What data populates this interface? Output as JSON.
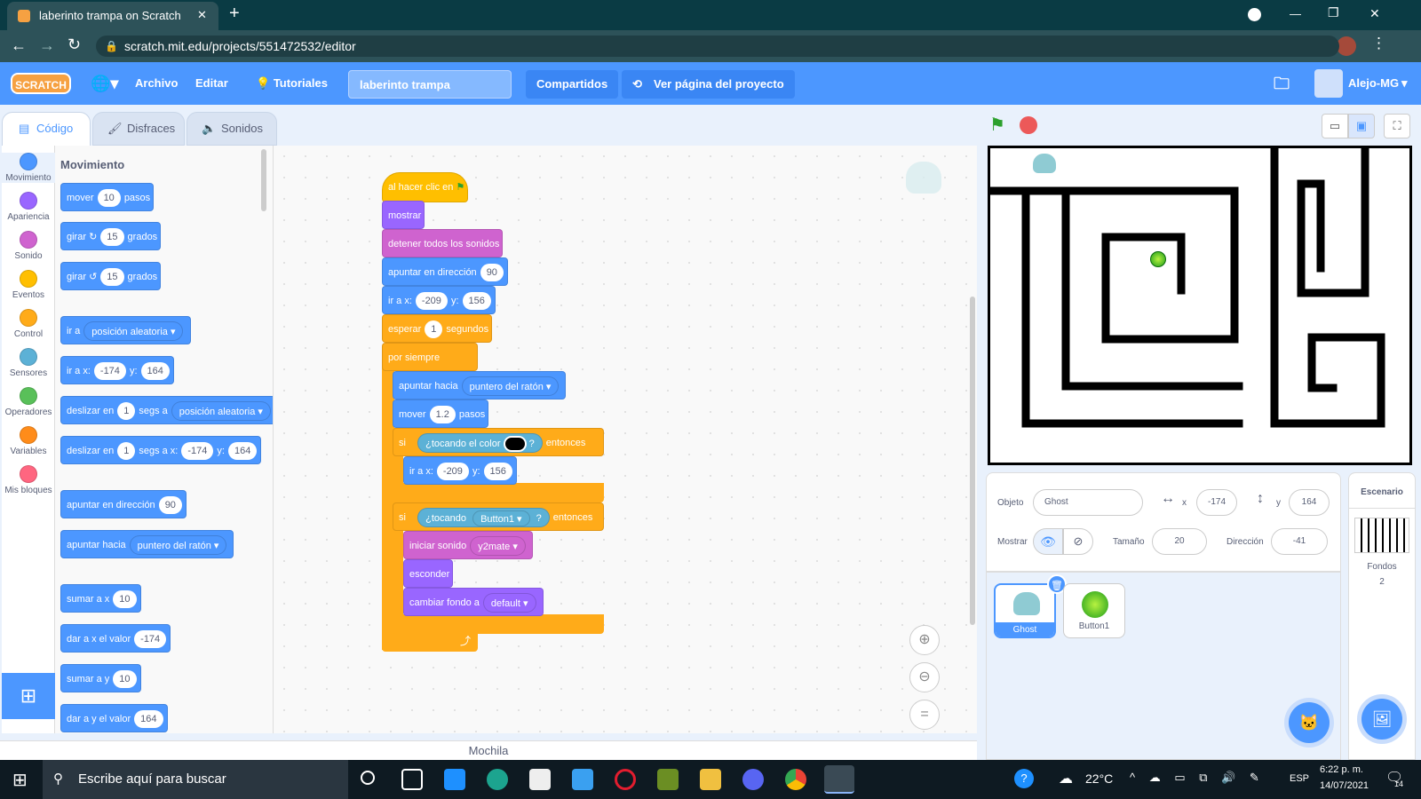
{
  "browser": {
    "tab_title": "laberinto trampa on Scratch",
    "url": "scratch.mit.edu/projects/551472532/editor",
    "new_tab": "+",
    "minimize": "—",
    "maximize": "❐",
    "close": "✕"
  },
  "menu": {
    "logo": "SCRATCH",
    "archivo": "Archivo",
    "editar": "Editar",
    "tutoriales": "Tutoriales",
    "project_title": "laberinto trampa",
    "compartidos": "Compartidos",
    "ver_pagina": "Ver página del proyecto",
    "user": "Alejo-MG"
  },
  "tabs": {
    "codigo": "Código",
    "disfraces": "Disfraces",
    "sonidos": "Sonidos"
  },
  "categories": [
    {
      "label": "Movimiento",
      "color": "#4c97ff"
    },
    {
      "label": "Apariencia",
      "color": "#9966ff"
    },
    {
      "label": "Sonido",
      "color": "#cf63cf"
    },
    {
      "label": "Eventos",
      "color": "#ffbf00"
    },
    {
      "label": "Control",
      "color": "#ffab19"
    },
    {
      "label": "Sensores",
      "color": "#5cb1d6"
    },
    {
      "label": "Operadores",
      "color": "#59c059"
    },
    {
      "label": "Variables",
      "color": "#ff8c1a"
    },
    {
      "label": "Mis bloques",
      "color": "#ff6680"
    }
  ],
  "palette": {
    "heading": "Movimiento",
    "mover": "mover",
    "mover_v": "10",
    "pasos": "pasos",
    "girar": "girar",
    "girar_v": "15",
    "grados": "grados",
    "ir_a": "ir a",
    "pos_aleatoria": "posición aleatoria",
    "ir_a_x": "ir a x:",
    "x_v": "-174",
    "y": "y:",
    "y_v": "164",
    "deslizar_en": "deslizar en",
    "one": "1",
    "segs_a": "segs a",
    "segs_a_x": "segs a x:",
    "apuntar_dir": "apuntar en dirección",
    "dir_v": "90",
    "apuntar_hacia": "apuntar hacia",
    "puntero": "puntero del ratón",
    "sumar_x": "sumar a x",
    "sumar_v": "10",
    "dar_x": "dar a x el valor",
    "sumar_y": "sumar a y",
    "dar_y": "dar a y el valor",
    "dar_y_v": "164"
  },
  "script": {
    "hat": "al hacer clic en",
    "mostrar": "mostrar",
    "detener": "detener todos los sonidos",
    "apuntar_dir": "apuntar en dirección",
    "dir_v": "90",
    "ir_a_x": "ir a x:",
    "x_v": "-209",
    "y": "y:",
    "y_v": "156",
    "esperar": "esperar",
    "esperar_v": "1",
    "segundos": "segundos",
    "por_siempre": "por siempre",
    "apuntar_hacia": "apuntar hacia",
    "puntero": "puntero del ratón",
    "mover": "mover",
    "mover_v": "1.2",
    "pasos": "pasos",
    "si": "si",
    "tocando_color": "¿tocando el color",
    "q": "?",
    "entonces": "entonces",
    "tocando": "¿tocando",
    "button1": "Button1",
    "iniciar_sonido": "iniciar sonido",
    "y2mate": "y2mate",
    "esconder": "esconder",
    "cambiar_fondo": "cambiar fondo a",
    "default": "default"
  },
  "mochila": "Mochila",
  "sprite_info": {
    "objeto": "Objeto",
    "name": "Ghost",
    "x_label": "x",
    "x": "-174",
    "y_label": "y",
    "y": "164",
    "mostrar": "Mostrar",
    "tamano": "Tamaño",
    "size": "20",
    "direccion": "Dirección",
    "dir": "-41"
  },
  "sprites": [
    {
      "name": "Ghost"
    },
    {
      "name": "Button1"
    }
  ],
  "stage_panel": {
    "title": "Escenario",
    "fondos": "Fondos",
    "count": "2"
  },
  "taskbar": {
    "search": "Escribe aquí para buscar",
    "temp": "22°C",
    "lang": "ESP",
    "time": "6:22 p. m.",
    "date": "14/07/2021",
    "notif": "14"
  }
}
